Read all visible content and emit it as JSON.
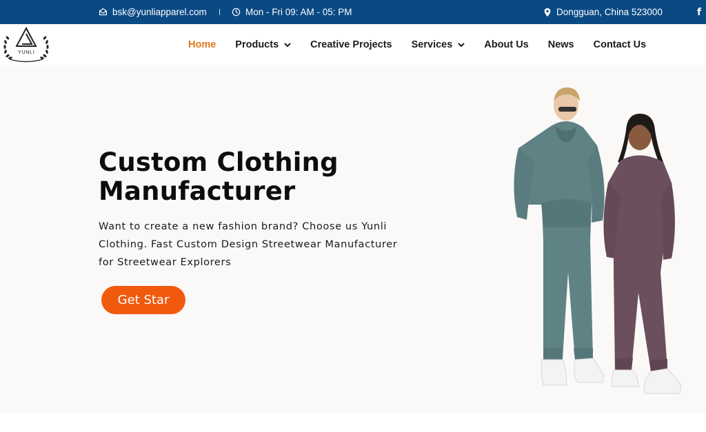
{
  "topbar": {
    "email": "bsk@yunliapparel.com",
    "hours": "Mon - Fri 09: AM - 05: PM",
    "location": "Dongguan, China 523000",
    "facebook_glyph": "f",
    "icons": {
      "email": "envelope-icon",
      "hours": "clock-icon",
      "location": "map-pin-icon",
      "social": "facebook-icon"
    }
  },
  "logo": {
    "text": "YUNLI"
  },
  "nav": {
    "items": [
      {
        "label": "Home",
        "active": true
      },
      {
        "label": "Products",
        "dropdown": true
      },
      {
        "label": "Creative Projects"
      },
      {
        "label": "Services",
        "dropdown": true
      },
      {
        "label": "About Us"
      },
      {
        "label": "News"
      },
      {
        "label": "Contact Us"
      }
    ]
  },
  "hero": {
    "title_line1": "Custom Clothing",
    "title_line2": "Manufacturer",
    "subtitle_line1": "Want to create a new fashion brand? Choose us Yunli",
    "subtitle_line2": "Clothing. Fast Custom Design Streetwear Manufacturer",
    "subtitle_line3": "for Streetwear Explorers",
    "cta_label": "Get Star"
  },
  "colors": {
    "topbar_bg": "#0a4a84",
    "accent_orange": "#f15a0e",
    "nav_active": "#e0771d",
    "hero_bg": "#fbf9f8",
    "hoodie_teal": "#5f8285",
    "hoodie_plum": "#6b4f5c"
  }
}
